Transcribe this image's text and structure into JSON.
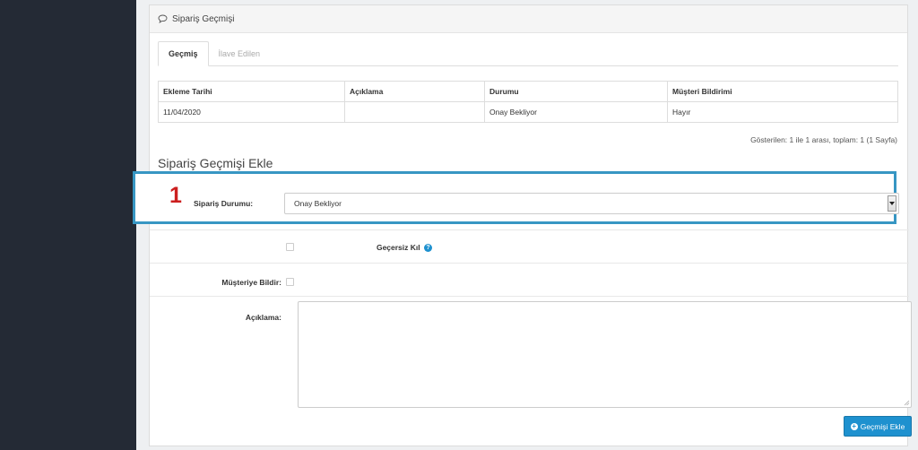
{
  "panel": {
    "title": "Sipariş Geçmişi"
  },
  "tabs": [
    {
      "label": "Geçmiş",
      "active": true
    },
    {
      "label": "İlave Edilen",
      "active": false
    }
  ],
  "history_table": {
    "headers": [
      "Ekleme Tarihi",
      "Açıklama",
      "Durumu",
      "Müşteri Bildirimi"
    ],
    "rows": [
      [
        "11/04/2020",
        "",
        "Onay Bekliyor",
        "Hayır"
      ]
    ]
  },
  "pagination_info": "Gösterilen: 1 ile 1 arası, toplam: 1 (1 Sayfa)",
  "add_history": {
    "section_title": "Sipariş Geçmişi Ekle",
    "step_marker": "1",
    "status_label": "Sipariş Durumu:",
    "status_value": "Onay Bekliyor",
    "override_label": "Geçersiz Kıl",
    "override_checked": false,
    "notify_label": "Müşteriye Bildir:",
    "notify_checked": false,
    "comment_label": "Açıklama:",
    "comment_value": "",
    "submit_label": "Geçmişi Ekle"
  },
  "colors": {
    "sidebar": "#242a35",
    "primary": "#1e91cf",
    "highlight_border": "#3796c3",
    "step_marker": "#cc1f1f"
  }
}
